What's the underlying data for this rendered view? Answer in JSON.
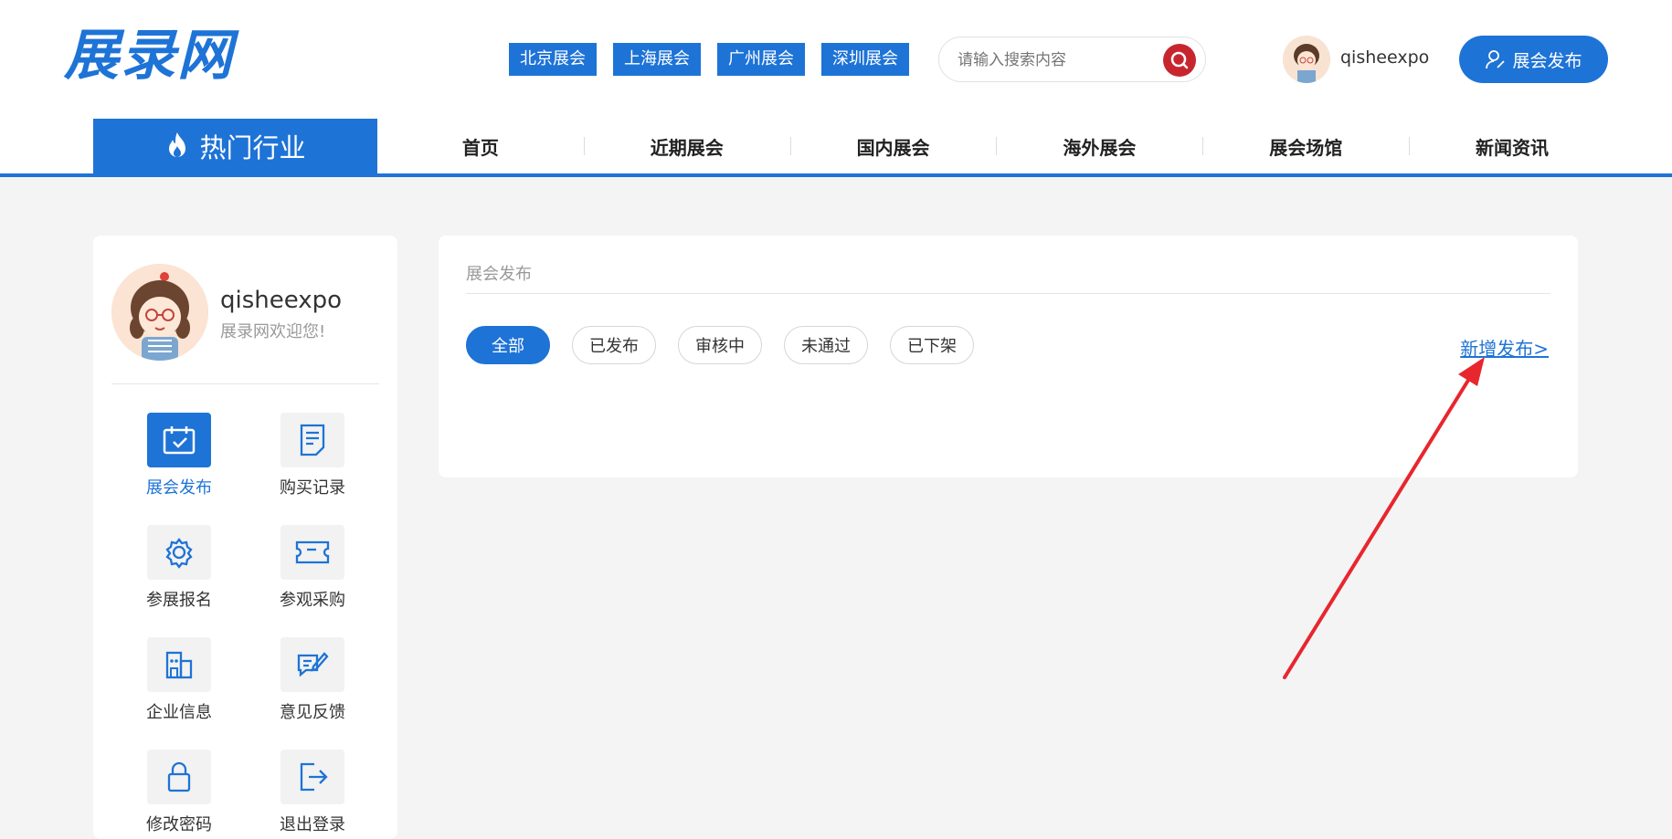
{
  "header": {
    "logo": "展录网",
    "city_tags": [
      "北京展会",
      "上海展会",
      "广州展会",
      "深圳展会"
    ],
    "search_placeholder": "请输入搜索内容",
    "username": "qisheexpo",
    "publish_button": "展会发布"
  },
  "nav": {
    "hot_label": "热门行业",
    "items": [
      "首页",
      "近期展会",
      "国内展会",
      "海外展会",
      "展会场馆",
      "新闻资讯"
    ]
  },
  "sidebar": {
    "name": "qisheexpo",
    "welcome": "展录网欢迎您!",
    "menu": [
      {
        "label": "展会发布",
        "icon": "calendar-icon",
        "active": true
      },
      {
        "label": "购买记录",
        "icon": "document-icon",
        "active": false
      },
      {
        "label": "参展报名",
        "icon": "gear-icon",
        "active": false
      },
      {
        "label": "参观采购",
        "icon": "ticket-icon",
        "active": false
      },
      {
        "label": "企业信息",
        "icon": "building-icon",
        "active": false
      },
      {
        "label": "意见反馈",
        "icon": "feedback-icon",
        "active": false
      },
      {
        "label": "修改密码",
        "icon": "lock-icon",
        "active": false
      },
      {
        "label": "退出登录",
        "icon": "logout-icon",
        "active": false
      }
    ]
  },
  "main": {
    "breadcrumb": "展会发布",
    "filters": [
      "全部",
      "已发布",
      "审核中",
      "未通过",
      "已下架"
    ],
    "active_filter": "全部",
    "new_link": "新增发布>"
  },
  "colors": {
    "brand": "#1e73d6",
    "search_button": "#c8262f",
    "annotation_arrow": "#e8262d"
  }
}
